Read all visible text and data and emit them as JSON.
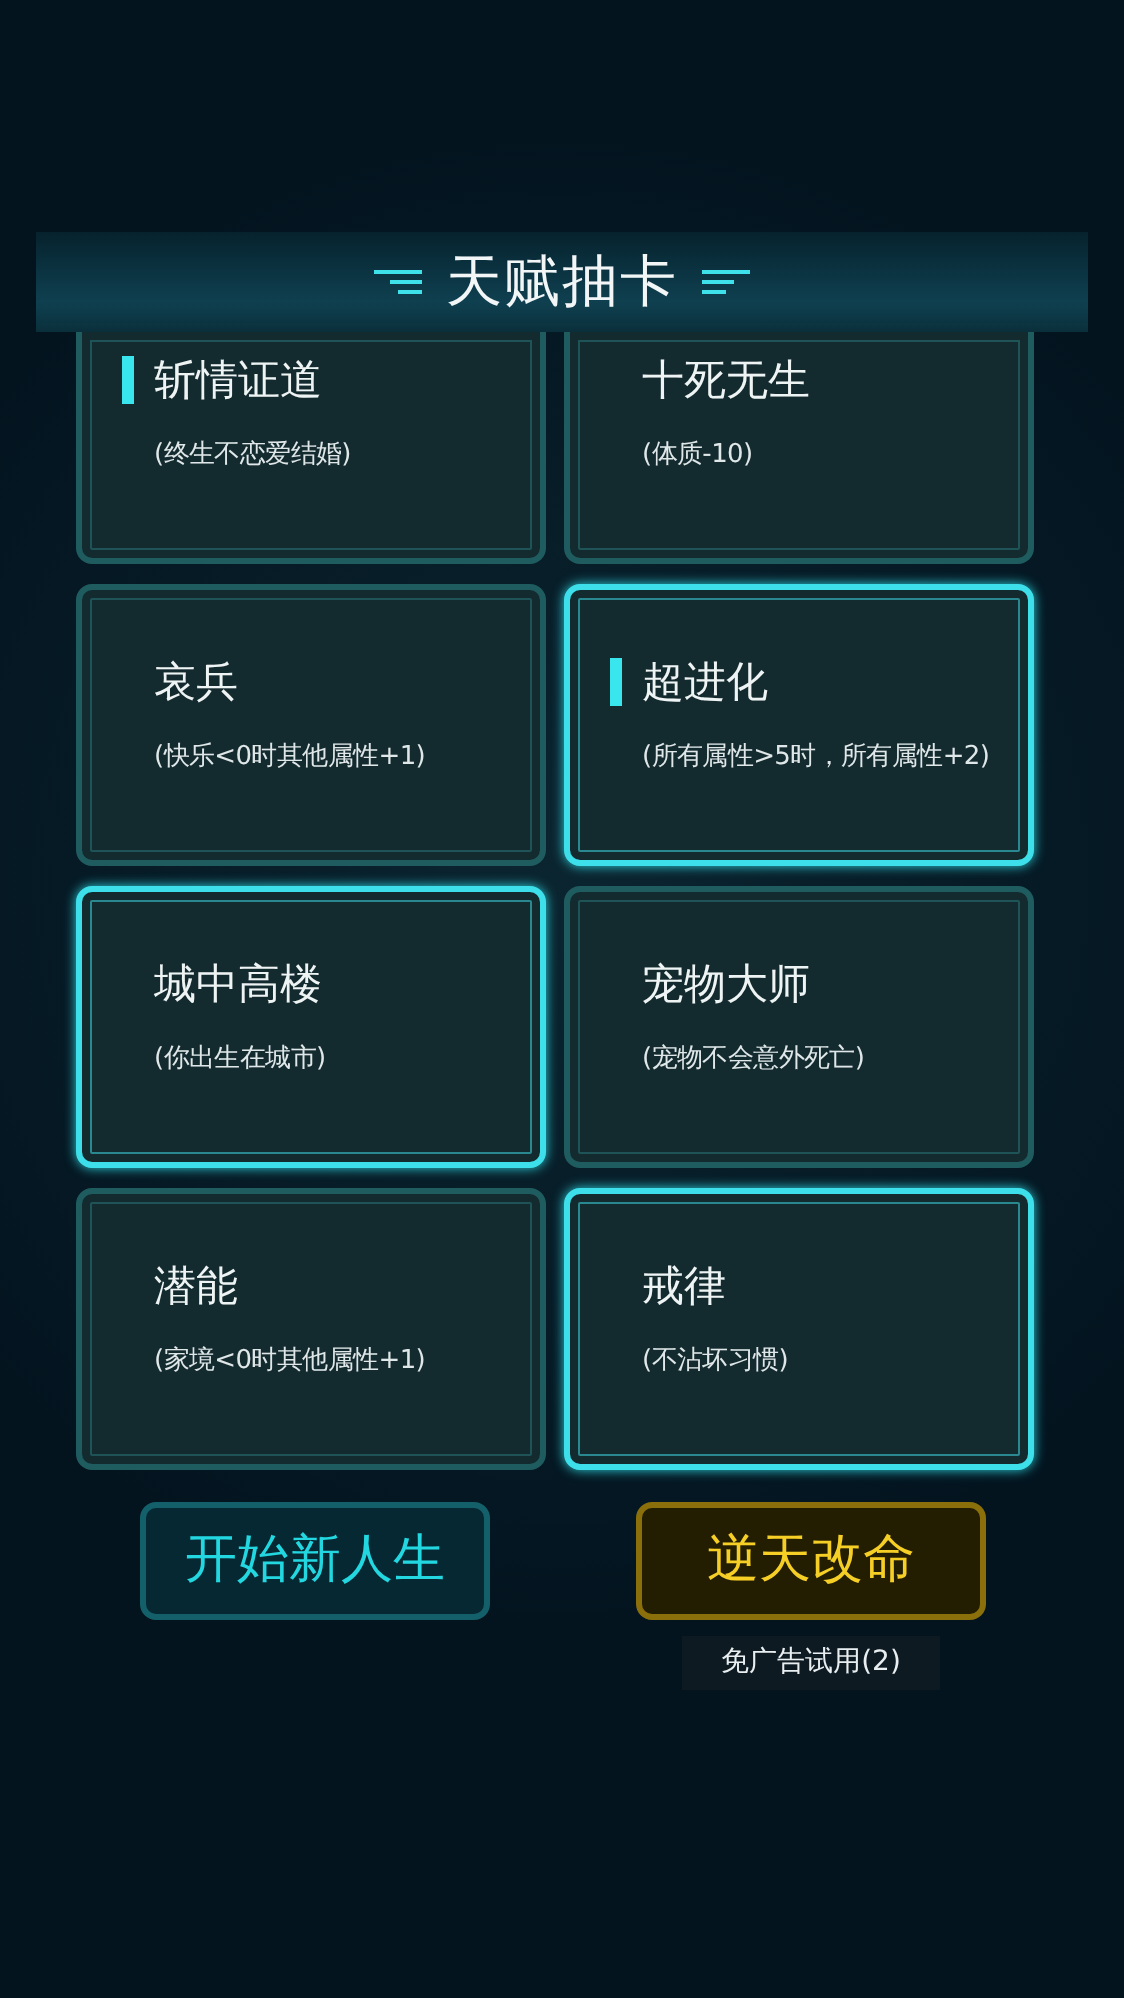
{
  "header": {
    "title": "天赋抽卡"
  },
  "cards": [
    {
      "name": "斩情证道",
      "effect": "(终生不恋爱结婚)",
      "selected": false,
      "flagged": true
    },
    {
      "name": "十死无生",
      "effect": "(体质-10)",
      "selected": false,
      "flagged": false
    },
    {
      "name": "哀兵",
      "effect": "(快乐<0时其他属性+1)",
      "selected": false,
      "flagged": false
    },
    {
      "name": "超进化",
      "effect": "(所有属性>5时，所有属性+2)",
      "selected": true,
      "flagged": true
    },
    {
      "name": "城中高楼",
      "effect": "(你出生在城市)",
      "selected": true,
      "flagged": false
    },
    {
      "name": "宠物大师",
      "effect": "(宠物不会意外死亡)",
      "selected": false,
      "flagged": false
    },
    {
      "name": "潜能",
      "effect": "(家境<0时其他属性+1)",
      "selected": false,
      "flagged": false
    },
    {
      "name": "戒律",
      "effect": "(不沾坏习惯)",
      "selected": true,
      "flagged": false
    }
  ],
  "buttons": [
    {
      "label": "开始新人生",
      "kind": "primary"
    },
    {
      "label": "逆天改命",
      "kind": "gold",
      "note": "免广告试用(2)"
    }
  ]
}
